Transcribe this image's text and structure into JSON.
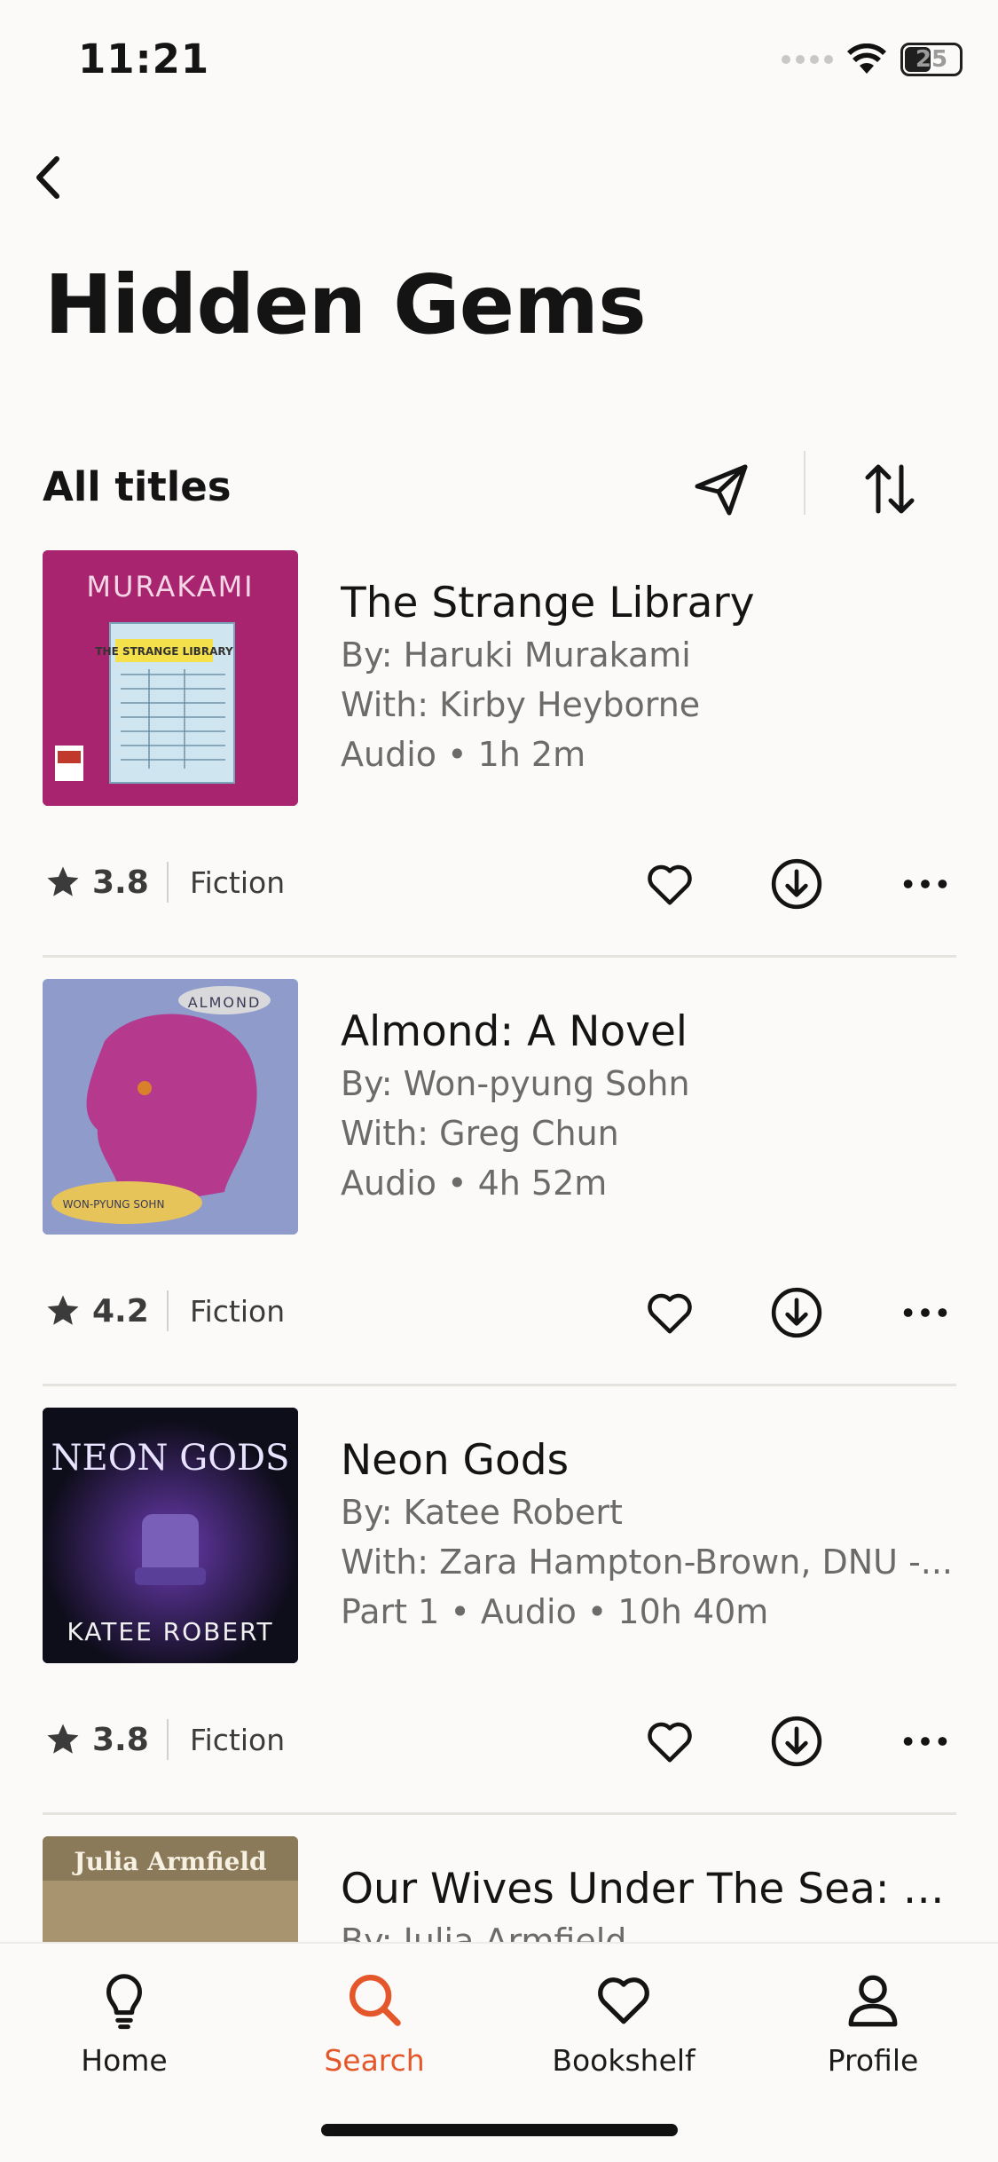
{
  "status_bar": {
    "time": "11:21",
    "battery": "25"
  },
  "page": {
    "title": "Hidden Gems"
  },
  "list_header": {
    "title": "All titles"
  },
  "books": [
    {
      "title": "The Strange Library",
      "author": "By: Haruki Murakami",
      "narrator": "With: Kirby Heyborne",
      "format": "Audio • 1h 2m",
      "rating": "3.8",
      "genre": "Fiction",
      "cover": {
        "bg": "#A8246E",
        "top_text": "MURAKAMI",
        "label": "THE STRANGE LIBRARY"
      }
    },
    {
      "title": "Almond: A Novel",
      "author": "By: Won-pyung Sohn",
      "narrator": "With: Greg Chun",
      "format": "Audio • 4h 52m",
      "rating": "4.2",
      "genre": "Fiction",
      "cover": {
        "bg": "#8E9BCB",
        "top_text": "ALMOND",
        "label": "WON-PYUNG SOHN"
      }
    },
    {
      "title": "Neon Gods",
      "author": "By: Katee Robert",
      "narrator": "With: Zara Hampton-Brown, DNU -...",
      "format": "Part 1 • Audio • 10h 40m",
      "rating": "3.8",
      "genre": "Fiction",
      "cover": {
        "bg": "#0E0D1A",
        "top_text": "NEON GODS",
        "label": "KATEE ROBERT"
      }
    },
    {
      "title": "Our Wives Under The Sea: Wi...",
      "author": "By: Julia Armfield",
      "cover": {
        "bg": "#8A7A5A",
        "top_text": "Julia Armfield"
      }
    }
  ],
  "nav": [
    {
      "label": "Home",
      "icon": "lightbulb-icon",
      "active": false
    },
    {
      "label": "Search",
      "icon": "search-icon",
      "active": true
    },
    {
      "label": "Bookshelf",
      "icon": "heart-icon",
      "active": false
    },
    {
      "label": "Profile",
      "icon": "person-icon",
      "active": false
    }
  ],
  "colors": {
    "accent": "#E4572B",
    "background": "#FBFAF8",
    "text": "#141414",
    "muted": "#6b6b6b"
  }
}
